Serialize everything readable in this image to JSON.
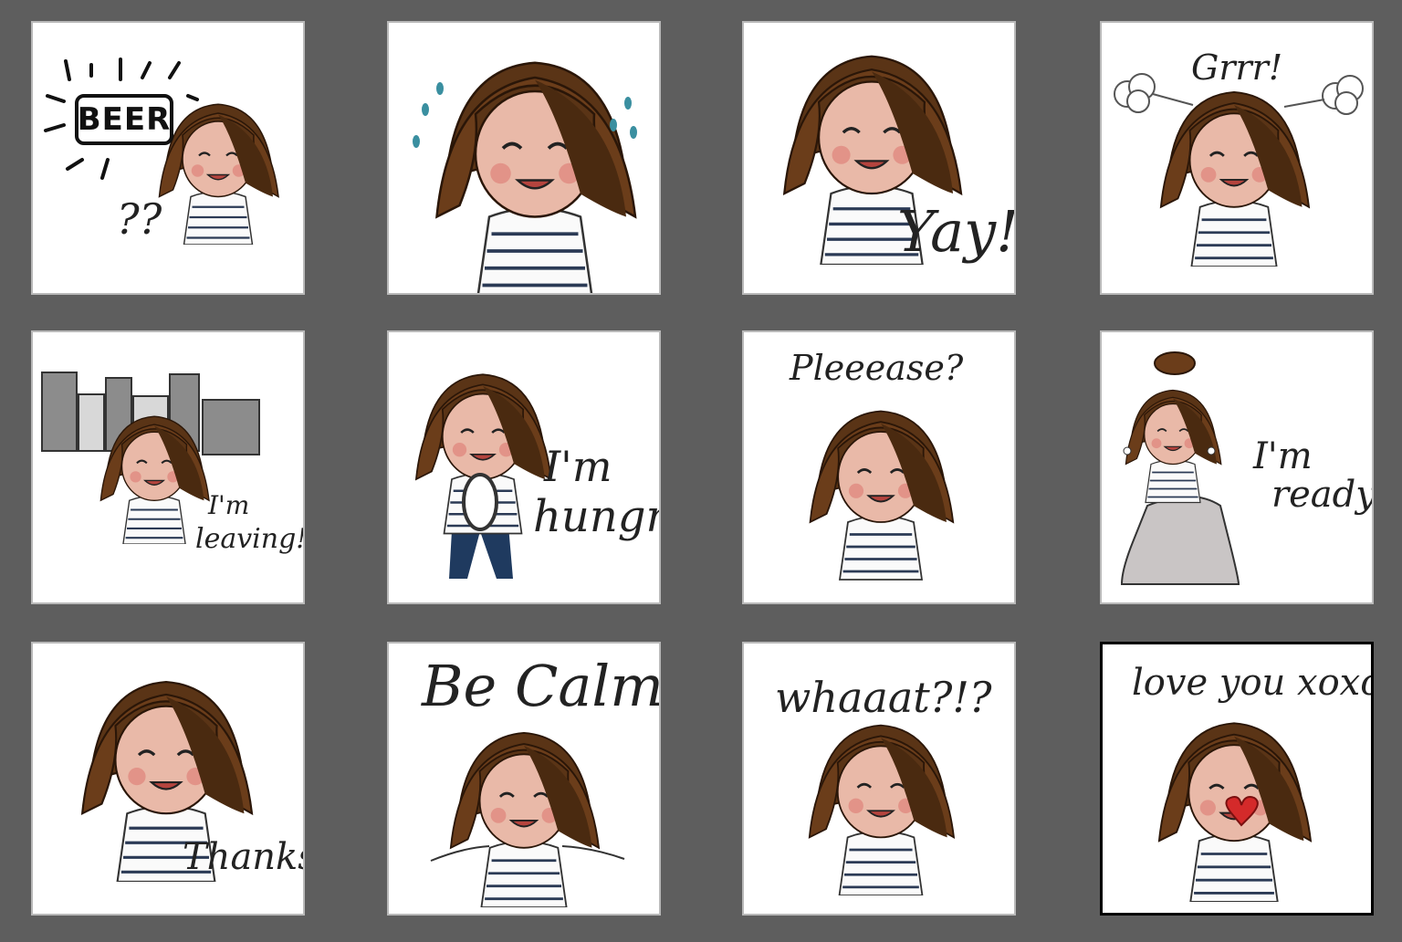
{
  "colors": {
    "hair": "#5a3416",
    "skin": "#e9b9a8",
    "blush": "#e08a80",
    "stripe": "#2b3a55",
    "background": "#5e5e5e"
  },
  "stickers": [
    {
      "caption": "BEER",
      "caption2": "??"
    },
    {
      "caption": ""
    },
    {
      "caption": "Yay!"
    },
    {
      "caption": "Grrr!"
    },
    {
      "caption": "I'm",
      "caption2": "leaving!"
    },
    {
      "caption": "I'm",
      "caption2": "hungry!"
    },
    {
      "caption": "Pleeease?"
    },
    {
      "caption": "I'm",
      "caption2": "ready!"
    },
    {
      "caption": "Thanks!"
    },
    {
      "caption": "Be Calm"
    },
    {
      "caption": "whaaat?!?"
    },
    {
      "caption": "love you xoxo"
    }
  ]
}
